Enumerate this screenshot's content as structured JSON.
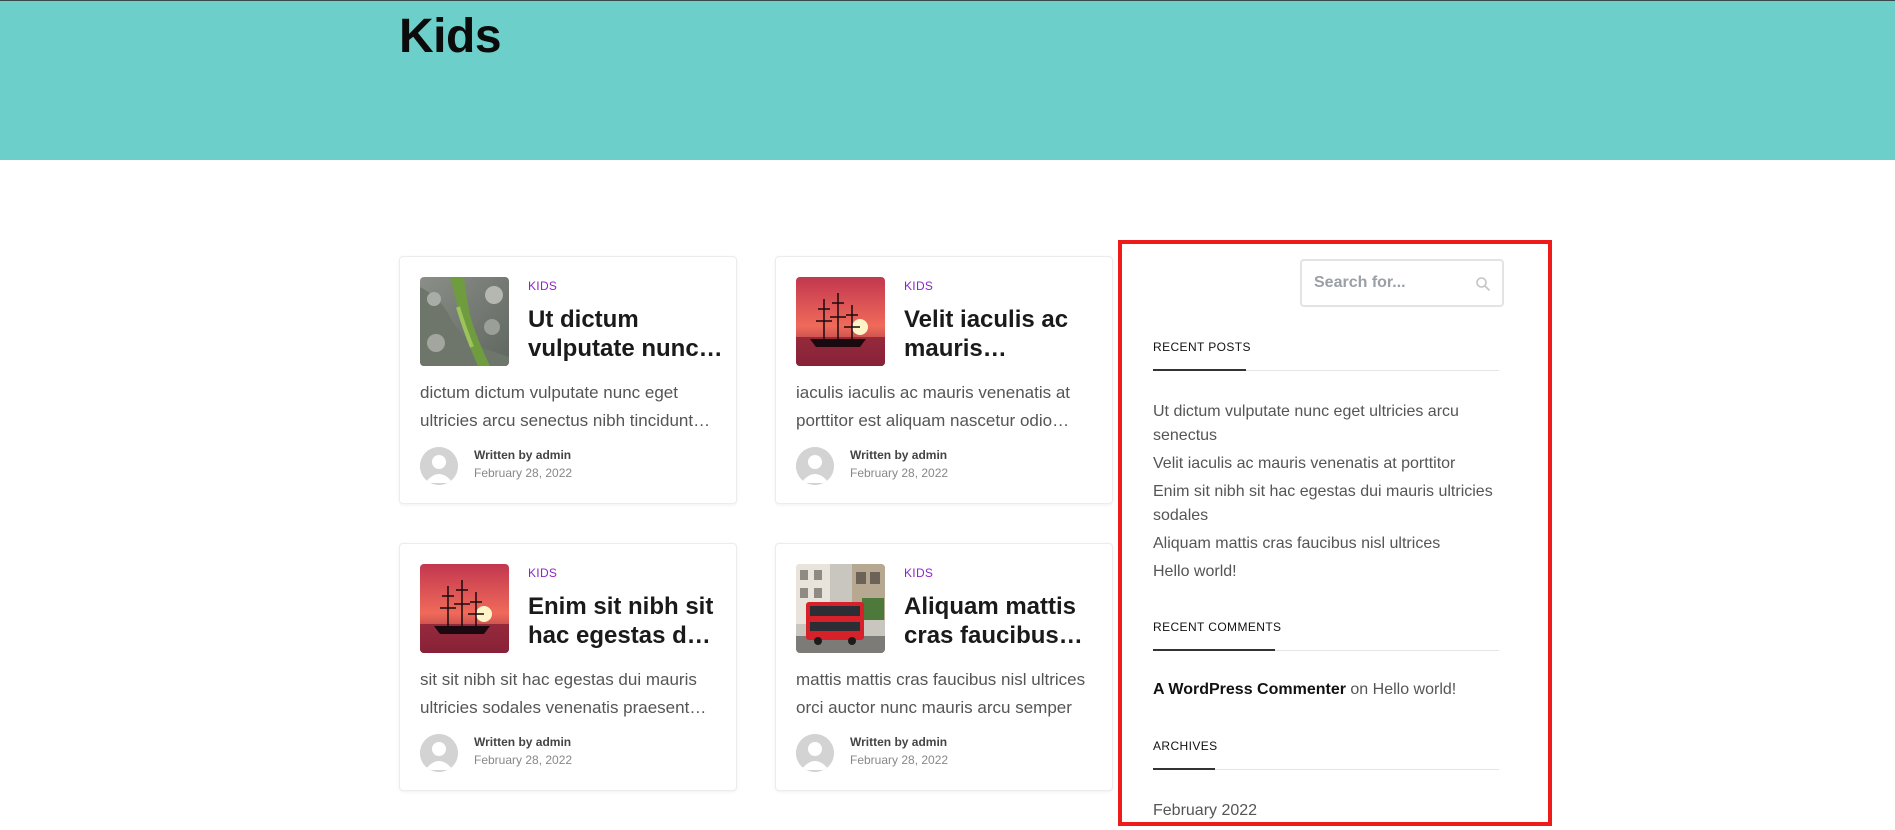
{
  "page": {
    "title": "Kids"
  },
  "colors": {
    "hero_bg": "#6ccfca",
    "category": "#8e24c9",
    "highlight_border": "#ee1b1b"
  },
  "posts": [
    {
      "category": "KIDS",
      "title": "Ut dictum vulputate nunc eget ultricies arcu senectus",
      "excerpt": "dictum dictum vulputate nunc eget ultricies arcu senectus nibh tincidunt venenatis",
      "author_label": "Written by admin",
      "date": "February 28, 2022",
      "thumb": "aerial-river-image"
    },
    {
      "category": "KIDS",
      "title": "Velit iaculis ac mauris venenatis at porttitor",
      "excerpt": "iaculis iaculis ac mauris venenatis at porttitor est aliquam nascetur odio ultrices",
      "author_label": "Written by admin",
      "date": "February 28, 2022",
      "thumb": "pirate-ship-sunset-image"
    },
    {
      "category": "KIDS",
      "title": "Enim sit nibh sit hac egestas dui mauris ultricies sodales",
      "excerpt": "sit sit nibh sit hac egestas dui mauris ultricies sodales venenatis praesent morbi",
      "author_label": "Written by admin",
      "date": "February 28, 2022",
      "thumb": "pirate-ship-sunset-image"
    },
    {
      "category": "KIDS",
      "title": "Aliquam mattis cras faucibus nisl ultrices",
      "excerpt": "mattis mattis cras faucibus nisl ultrices orci auctor nunc mauris arcu semper",
      "author_label": "Written by admin",
      "date": "February 28, 2022",
      "thumb": "red-bus-street-image"
    }
  ],
  "sidebar": {
    "search": {
      "placeholder": "Search for...",
      "value": ""
    },
    "recent_posts": {
      "title": "RECENT POSTS",
      "items": [
        "Ut dictum vulputate nunc eget ultricies arcu senectus",
        "Velit iaculis ac mauris venenatis at porttitor",
        "Enim sit nibh sit hac egestas dui mauris ultricies sodales",
        "Aliquam mattis cras faucibus nisl ultrices",
        "Hello world!"
      ]
    },
    "recent_comments": {
      "title": "RECENT COMMENTS",
      "author": "A WordPress Commenter",
      "connector": "on",
      "post": "Hello world!"
    },
    "archives": {
      "title": "ARCHIVES",
      "items": [
        "February 2022"
      ]
    }
  }
}
